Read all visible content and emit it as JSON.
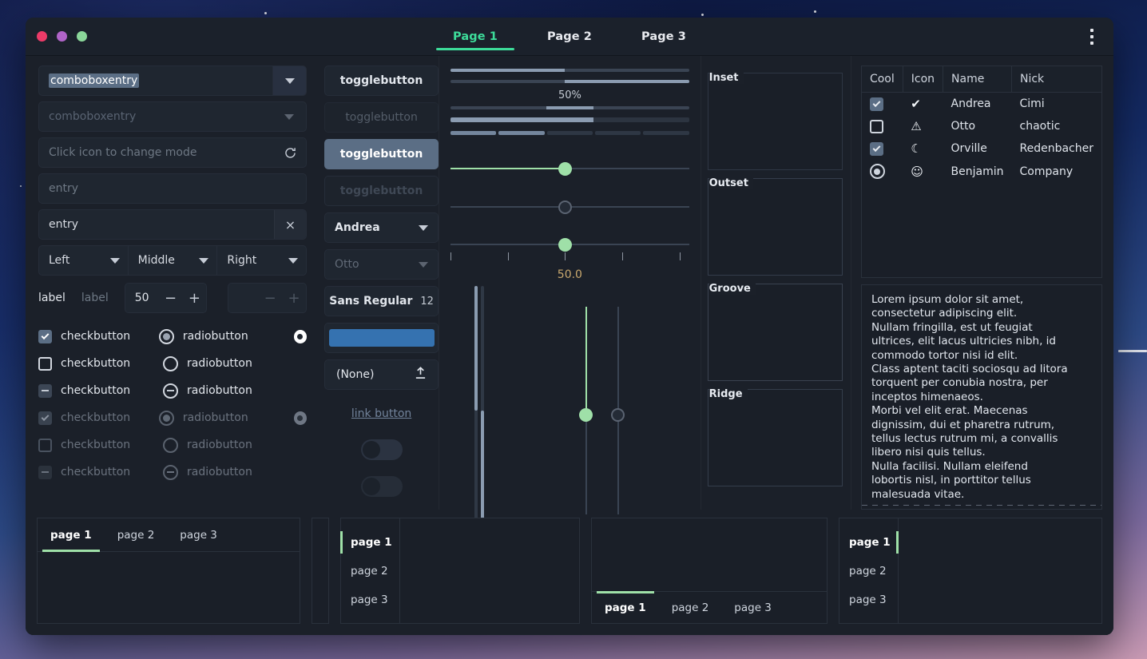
{
  "window": {
    "controls": [
      "close",
      "minimize",
      "maximize"
    ],
    "tabs": [
      {
        "label": "Page 1",
        "active": true
      },
      {
        "label": "Page 2",
        "active": false
      },
      {
        "label": "Page 3",
        "active": false
      }
    ],
    "menu_label": "menu"
  },
  "colors": {
    "accent_green": "#3ddc9a",
    "slider_green": "#9fe0a8",
    "selection_blue": "#5b6e85",
    "color_swatch": "#3572b0",
    "scale_value_text": "#c9a86e"
  },
  "column1": {
    "comboboxentry_selected": "comboboxentry",
    "comboboxentry_placeholder": "comboboxentry",
    "mode_entry_placeholder": "Click icon to change mode",
    "entry_placeholder": "entry",
    "entry_value": "entry",
    "clear_label": "×",
    "aligns": [
      "Left",
      "Middle",
      "Right"
    ],
    "label_enabled": "label",
    "label_disabled": "label",
    "spin_value": "50",
    "spin_minus": "−",
    "spin_plus": "+",
    "spin2_value": "",
    "checks": [
      {
        "check_state": "checked",
        "check_label": "checkbutton",
        "radio_state": "checked",
        "radio_label": "radiobutton",
        "extra": "on",
        "disabled": false
      },
      {
        "check_state": "unchecked",
        "check_label": "checkbutton",
        "radio_state": "unchecked",
        "radio_label": "radiobutton",
        "extra": null,
        "disabled": false
      },
      {
        "check_state": "mixed",
        "check_label": "checkbutton",
        "radio_state": "mixed",
        "radio_label": "radiobutton",
        "extra": null,
        "disabled": false
      },
      {
        "check_state": "checked",
        "check_label": "checkbutton",
        "radio_state": "checked",
        "radio_label": "radiobutton",
        "extra": "on",
        "disabled": true
      },
      {
        "check_state": "unchecked",
        "check_label": "checkbutton",
        "radio_state": "unchecked",
        "radio_label": "radiobutton",
        "extra": null,
        "disabled": true
      },
      {
        "check_state": "mixed",
        "check_label": "checkbutton",
        "radio_state": "mixed",
        "radio_label": "radiobutton",
        "extra": null,
        "disabled": true
      }
    ]
  },
  "column2": {
    "toggles": [
      {
        "label": "togglebutton",
        "state": "normal"
      },
      {
        "label": "togglebutton",
        "state": "disabled"
      },
      {
        "label": "togglebutton",
        "state": "active"
      },
      {
        "label": "togglebutton",
        "state": "active-disabled"
      }
    ],
    "combo_enabled": "Andrea",
    "combo_disabled": "Otto",
    "font_name": "Sans Regular",
    "font_size": "12",
    "file_value": "(None)",
    "link_label": "link button",
    "switch1": "off",
    "switch2": "off"
  },
  "column3": {
    "progress_percent_label": "50%",
    "progressbars": [
      {
        "name": "pbar-1",
        "fill": 48,
        "align": "left"
      },
      {
        "name": "pbar-2",
        "fill": 52,
        "align": "right"
      },
      {
        "name": "pbar-3",
        "fill": 20,
        "align": "center"
      },
      {
        "name": "pbar-4",
        "fill": 60,
        "align": "left"
      }
    ],
    "level_segments": [
      true,
      true,
      false,
      false,
      false
    ],
    "scales": [
      {
        "name": "scale-green",
        "value": 50,
        "style": "filled"
      },
      {
        "name": "scale-hollow",
        "value": 50,
        "style": "hollow"
      },
      {
        "name": "scale-marks",
        "value": 50,
        "style": "marks"
      }
    ],
    "scale_value_label": "50.0",
    "vertical_progress": [
      {
        "name": "vprog-1",
        "fill": 52
      },
      {
        "name": "vprog-2",
        "fill": 48
      }
    ],
    "vertical_scales": [
      {
        "name": "vscale-green",
        "value": 50,
        "style": "filled"
      },
      {
        "name": "vscale-hollow",
        "value": 50,
        "style": "hollow"
      }
    ]
  },
  "column4": {
    "frames": [
      "Inset",
      "Outset",
      "Groove",
      "Ridge"
    ]
  },
  "column5": {
    "table": {
      "headers": [
        "Cool",
        "Icon",
        "Name",
        "Nick"
      ],
      "rows": [
        {
          "cool": "checked",
          "cool_type": "check",
          "icon": "check-circle-icon",
          "icon_glyph": "✔",
          "name": "Andrea",
          "nick": "Cimi"
        },
        {
          "cool": "unchecked",
          "cool_type": "check",
          "icon": "warning-icon",
          "icon_glyph": "!",
          "name": "Otto",
          "nick": "chaotic"
        },
        {
          "cool": "checked",
          "cool_type": "check",
          "icon": "moon-icon",
          "icon_glyph": "☾",
          "name": "Orville",
          "nick": "Redenbacher"
        },
        {
          "cool": "selected",
          "cool_type": "radio",
          "icon": "monkey-icon",
          "icon_glyph": "ὃ5",
          "name": "Benjamin",
          "nick": "Company"
        }
      ]
    },
    "text_lines": [
      "Lorem ipsum dolor sit amet,",
      "consectetur adipiscing elit.",
      "Nullam fringilla, est ut feugiat",
      "ultrices, elit lacus ultricies nibh, id",
      "commodo tortor nisi id elit.",
      "Class aptent taciti sociosqu ad litora",
      "torquent per conubia nostra, per",
      "inceptos himenaeos.",
      "Morbi vel elit erat. Maecenas",
      "dignissim, dui et pharetra rutrum,",
      "tellus lectus rutrum mi, a convallis",
      "libero nisi quis tellus.",
      "Nulla facilisi. Nullam eleifend",
      "lobortis nisl, in porttitor tellus",
      "malesuada vitae."
    ]
  },
  "bottom": {
    "notebook_top": {
      "tabs": [
        "page 1",
        "page 2",
        "page 3"
      ],
      "active": 0,
      "position": "top"
    },
    "notebook_left": {
      "tabs": [
        "page 1",
        "page 2",
        "page 3"
      ],
      "active": 0,
      "position": "left"
    },
    "notebook_bottom": {
      "tabs": [
        "page 1",
        "page 2",
        "page 3"
      ],
      "active": 0,
      "position": "bottom"
    },
    "notebook_right": {
      "tabs": [
        "page 1",
        "page 2",
        "page 3"
      ],
      "active": 0,
      "position": "right"
    }
  }
}
